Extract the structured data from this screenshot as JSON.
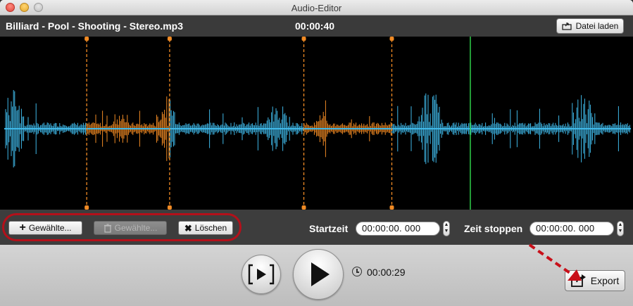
{
  "window": {
    "title": "Audio-Editor"
  },
  "header": {
    "file_name": "Billiard - Pool - Shooting - Stereo.mp3",
    "duration": "00:00:40",
    "load_button": "Datei laden"
  },
  "waveform": {
    "selection_color": "#f08a24",
    "wave_color": "#3fb8e8",
    "playhead_color": "#2fd04a",
    "selections": [
      {
        "start_fraction": 0.137,
        "end_fraction": 0.268
      },
      {
        "start_fraction": 0.48,
        "end_fraction": 0.619
      }
    ],
    "playhead_fraction": 0.743
  },
  "toolbar": {
    "add_button": "Gewählte...",
    "delete_selected_button": "Gewählte...",
    "clear_button": "Löschen",
    "start_label": "Startzeit",
    "start_value": "00:00:00. 000",
    "stop_label": "Zeit stoppen",
    "stop_value": "00:00:00. 000"
  },
  "player": {
    "position": "00:00:29",
    "export_button": "Export"
  },
  "colors": {
    "highlight_oval": "#b4101a"
  }
}
